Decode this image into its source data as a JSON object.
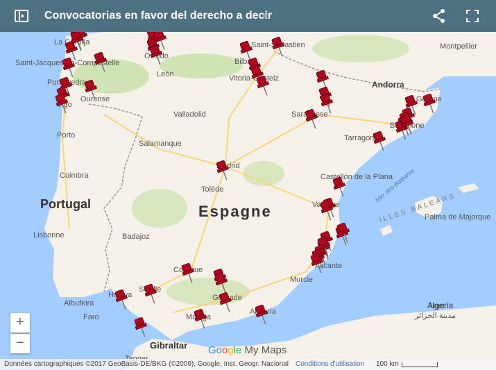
{
  "header": {
    "title": "Convocatorias en favor del derecho a decir",
    "icons": [
      "expand-sidebar-icon",
      "star-icon",
      "share-icon",
      "fullscreen-icon"
    ]
  },
  "map": {
    "colors": {
      "sea": "#a3ccff",
      "land": "#f5f1e8",
      "green": "#cfe3b4",
      "border": "#9a9a9a",
      "pin": "#b0081e",
      "road": "#fbd37a",
      "topbar": "#4d7181"
    },
    "labels": {
      "country_portugal": "Portugal",
      "country_spain": "Espagne",
      "country_andorra": "Andorra",
      "country_algeria": "Algeria",
      "islands": "ILLES BALEARS",
      "sea": "Mer des Baléares",
      "cities": [
        "La Coruña",
        "Saint-Jacques-de-Compostelle",
        "Pontevedra",
        "Vigo",
        "Ourense",
        "Oviedo",
        "León",
        "Bilbao",
        "Vitoria-Gasteiz",
        "Saint-Sébastien",
        "Montpellier",
        "Valladolid",
        "Salamanque",
        "Saragosse",
        "Gérone",
        "Barcelone",
        "Tarragone",
        "Porto",
        "Coimbra",
        "Madrid",
        "Tolède",
        "Castellón de la Plana",
        "Valence",
        "Palma de Majorque",
        "Lisbonne",
        "Badajoz",
        "Alicante",
        "Murcie",
        "Cordoue",
        "Séville",
        "Grenade",
        "Huelva",
        "Albufeira",
        "Faro",
        "Malaga",
        "Almería",
        "Gibraltar",
        "Tanger",
        "Alger",
        "مدينة الجزائر"
      ]
    },
    "pin_count": 52
  },
  "zoom": {
    "in": "+",
    "out": "−"
  },
  "footer": {
    "attribution": "Données cartographiques ©2017 GeoBasis-DE/BKG (©2009), Google, Inst. Geogr. Nacional",
    "terms": "Conditions d'utilisation",
    "scale": "100 km"
  },
  "logo": {
    "g1": "Go",
    "g2": "o",
    "g3": "g",
    "g4": "le",
    "suffix": " My Maps"
  }
}
